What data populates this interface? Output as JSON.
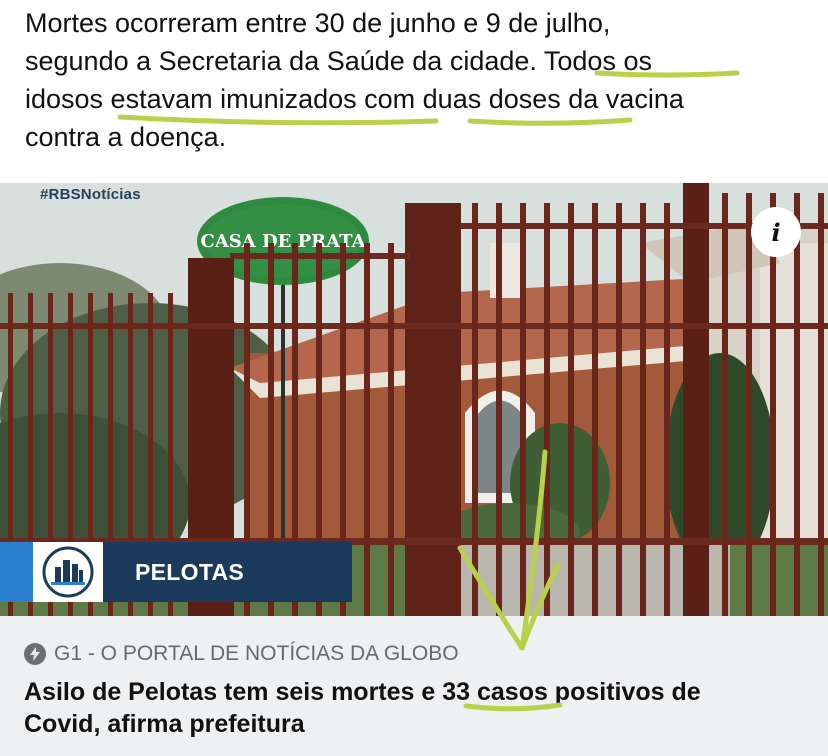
{
  "caption": {
    "lines": [
      "Mortes ocorreram entre 30 de junho e 9 de julho,",
      "segundo a Secretaria da Saúde da cidade. Todos os",
      "idosos estavam imunizados com duas doses da vacina",
      "contra a doença."
    ]
  },
  "photo": {
    "watermark": "#RBSNotícias",
    "sign_text": "CASA DE PRATA",
    "city_label": "PELOTAS",
    "info_icon": "i"
  },
  "link_card": {
    "source": "G1 - O PORTAL DE NOTÍCIAS DA GLOBO",
    "headline_lines": [
      "Asilo de Pelotas tem seis mortes e 33 casos positivos de",
      "Covid, afirma prefeitura"
    ]
  },
  "colors": {
    "annotation": "#b7d24a",
    "banner_dark": "#1c3a5c",
    "banner_accent": "#2b7fd0",
    "card_background": "#eef0f2"
  },
  "icons": {
    "info": "info-icon",
    "source": "lightning-icon",
    "city_logo": "city-skyline-icon"
  }
}
